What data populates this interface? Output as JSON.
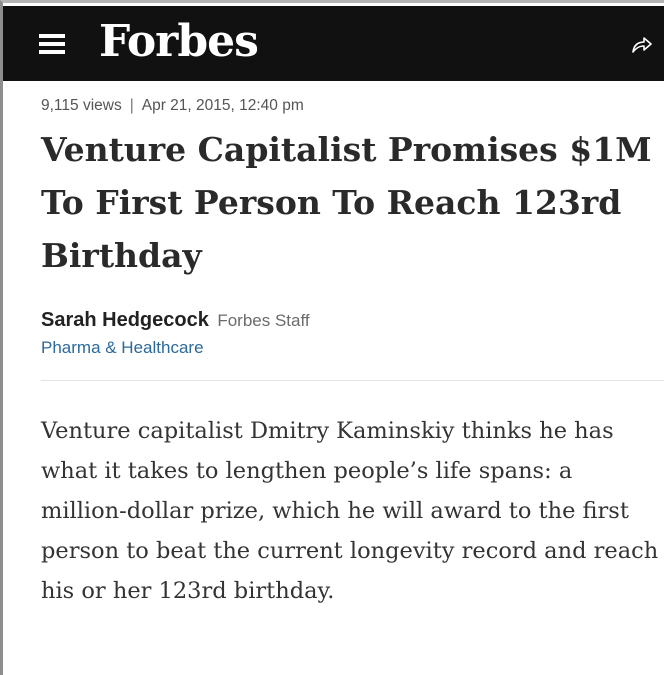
{
  "header": {
    "logo_text": "Forbes",
    "menu_icon": "hamburger-menu-icon",
    "share_icon": "share-arrow-icon",
    "background_color": "#111111"
  },
  "article": {
    "views": "9,115 views",
    "separator": "|",
    "date": "Apr 21, 2015, 12:40 pm",
    "headline": "Venture Capitalist Promises $1M To First Person To Reach 123rd Birthday",
    "author_name": "Sarah Hedgecock",
    "author_role": "Forbes Staff",
    "channel": "Pharma & Healthcare",
    "channel_color": "#2b6a99",
    "lead_paragraph": "Venture capitalist Dmitry Kaminskiy thinks he has what it takes to lengthen people’s life spans: a million-dollar prize, which he will award to the first person to beat the current longevity record and reach his or her 123rd birthday."
  }
}
